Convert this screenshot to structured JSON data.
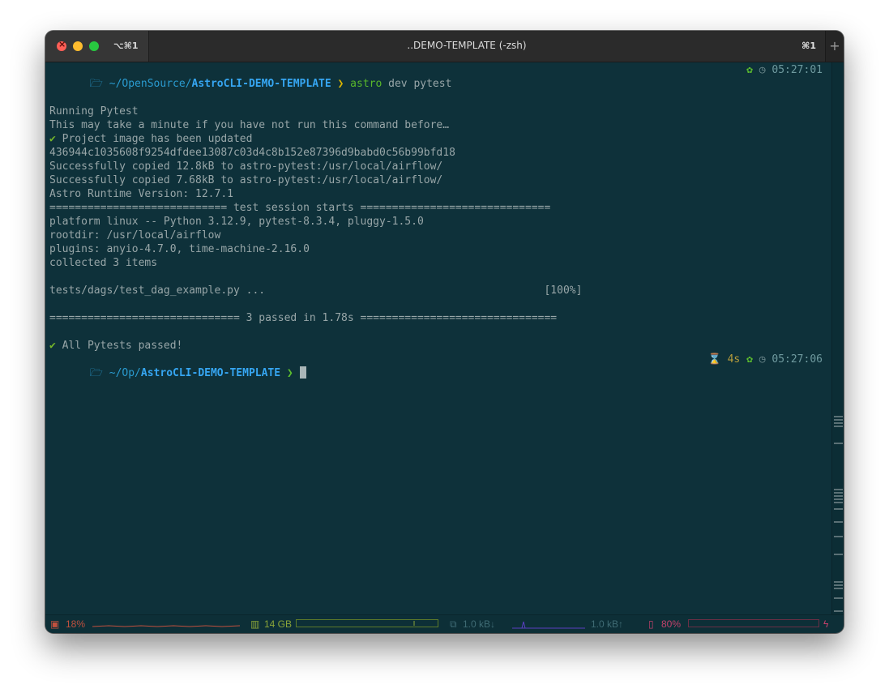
{
  "window": {
    "title": "..DEMO-TEMPLATE (-zsh)",
    "tab_shortcut_left": "⌥⌘1",
    "tab_shortcut_right": "⌘1",
    "new_tab_label": "+"
  },
  "prompt1": {
    "apple": "",
    "folder": "🗁",
    "path_prefix": "~/OpenSource/",
    "path_dir": "AstroCLI-DEMO-TEMPLATE",
    "chevron": "❯",
    "command": "astro",
    "args": "dev pytest",
    "status_icon": "✿",
    "clock_icon": "◷",
    "time": "05:27:01"
  },
  "output": [
    "Running Pytest",
    "This may take a minute if you have not run this command before…",
    "Project image has been updated",
    "436944c1035608f9254dfdee13087c03d4c8b152e87396d9babd0c56b99bfd18",
    "Successfully copied 12.8kB to astro-pytest:/usr/local/airflow/",
    "Successfully copied 7.68kB to astro-pytest:/usr/local/airflow/",
    "Astro Runtime Version: 12.7.1",
    "============================ test session starts ==============================",
    "platform linux -- Python 3.12.9, pytest-8.3.4, pluggy-1.5.0",
    "rootdir: /usr/local/airflow",
    "plugins: anyio-4.7.0, time-machine-2.16.0",
    "collected 3 items",
    "tests/dags/test_dag_example.py ...                                            [100%]",
    "============================== 3 passed in 1.78s ===============================",
    "All Pytests passed!"
  ],
  "check_mark": "✔",
  "prompt2": {
    "apple": "",
    "folder": "🗁",
    "path_prefix": "~/Op/",
    "path_dir": "AstroCLI-DEMO-TEMPLATE",
    "chevron": "❯",
    "hourglass_icon": "⌛",
    "duration": "4s",
    "status_icon": "✿",
    "clock_icon": "◷",
    "time": "05:27:06"
  },
  "statusbar": {
    "cpu_icon": "▣",
    "cpu": "18%",
    "mem_icon": "▥",
    "mem": "14 GB",
    "net_icon": "⧉",
    "net_down": "1.0 kB↓",
    "net_up": "1.0 kB↑",
    "battery_icon": "▯",
    "battery": "80%",
    "charging_icon": "ϟ",
    "cpu_color": "#c0503e",
    "mem_color": "#8aa438",
    "net_color": "#3f6b74",
    "battery_color": "#c0406a"
  }
}
